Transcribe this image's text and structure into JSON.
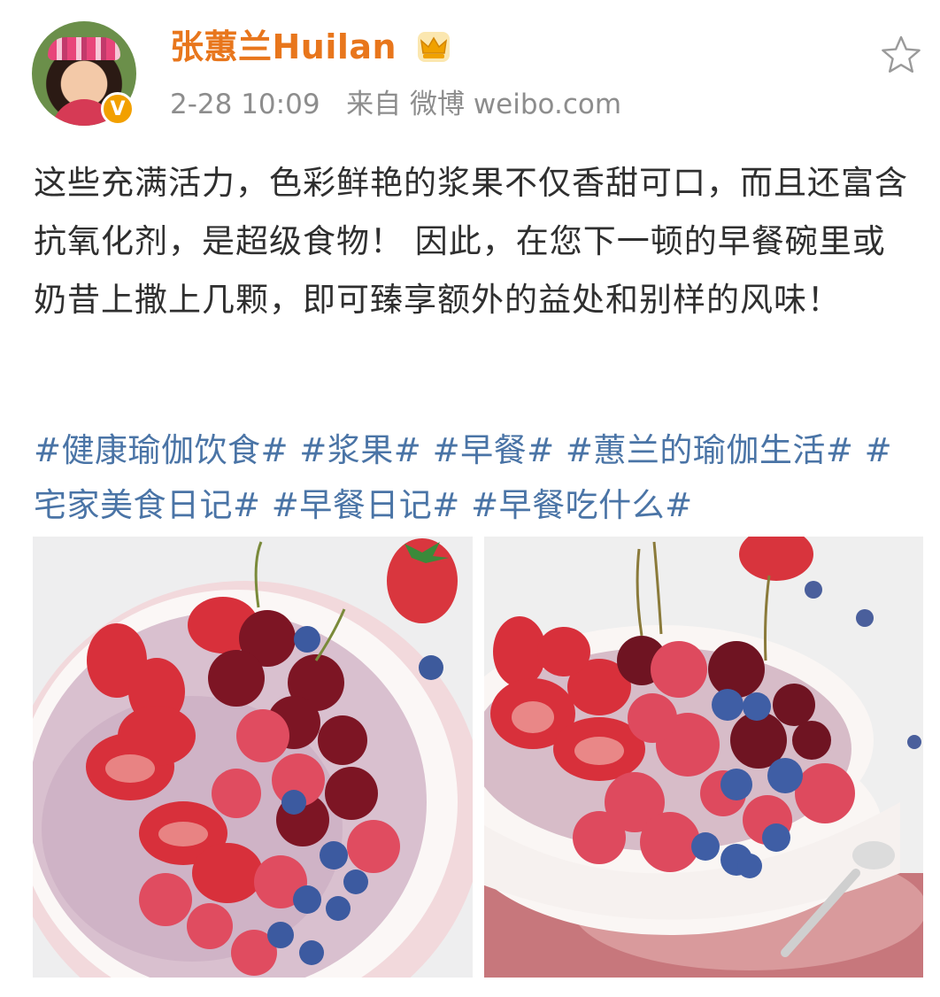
{
  "post": {
    "author": {
      "name": "张蕙兰Huilan",
      "verified_badge": "V"
    },
    "meta": {
      "time": "2-28 10:09",
      "source_prefix": "来自",
      "source": "微博 weibo.com"
    },
    "text": "这些充满活力，色彩鲜艳的浆果不仅香甜可口，而且还富含抗氧化剂，是超级食物！ 因此，在您下一顿的早餐碗里或奶昔上撒上几颗，即可臻享额外的益处和别样的风味！",
    "hashtags": [
      "#健康瑜伽饮食#",
      "#浆果#",
      "#早餐#",
      "#蕙兰的瑜伽生活#",
      "#宅家美食日记#",
      "#早餐日记#",
      "#早餐吃什么#"
    ]
  },
  "icons": {
    "favorite": "star-outline-icon",
    "vip": "crown-icon",
    "verified": "verified-badge-icon"
  },
  "colors": {
    "username": "#e8761c",
    "hashtag": "#4a74a6",
    "meta": "#8d8d8d",
    "body_text": "#2f2f2f",
    "verified": "#f2a000"
  }
}
